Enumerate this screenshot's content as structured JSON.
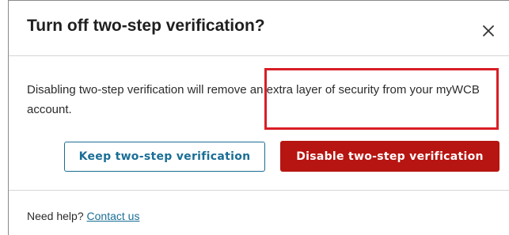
{
  "dialog": {
    "title": "Turn off two-step verification?",
    "message": "Disabling two-step verification will remove an extra layer of security from your myWCB account.",
    "keep_button_label": "Keep two-step verification",
    "disable_button_label": "Disable two-step verification",
    "close_icon": "close-icon",
    "footer": {
      "help_text": "Need help?",
      "contact_link_label": "Contact us"
    }
  },
  "colors": {
    "primary_blue": "#1a6e95",
    "danger_red": "#b71511",
    "highlight_red": "#d81e26"
  }
}
